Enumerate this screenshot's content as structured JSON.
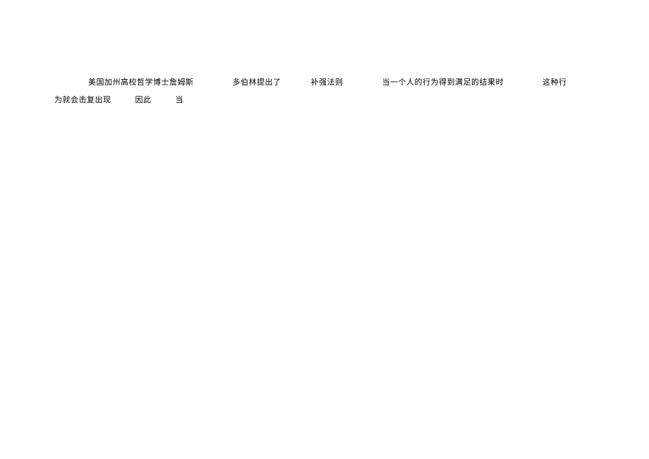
{
  "paragraph": {
    "seg1": "美国加州高校哲学博士詹姆斯",
    "seg2": "多伯林提出了",
    "seg3": "补强法则",
    "seg4": "当一个人的行为得到满足的结果时",
    "seg5": "这种行",
    "seg6": "为就会击复出现",
    "seg7": "因此",
    "seg8": "当"
  }
}
